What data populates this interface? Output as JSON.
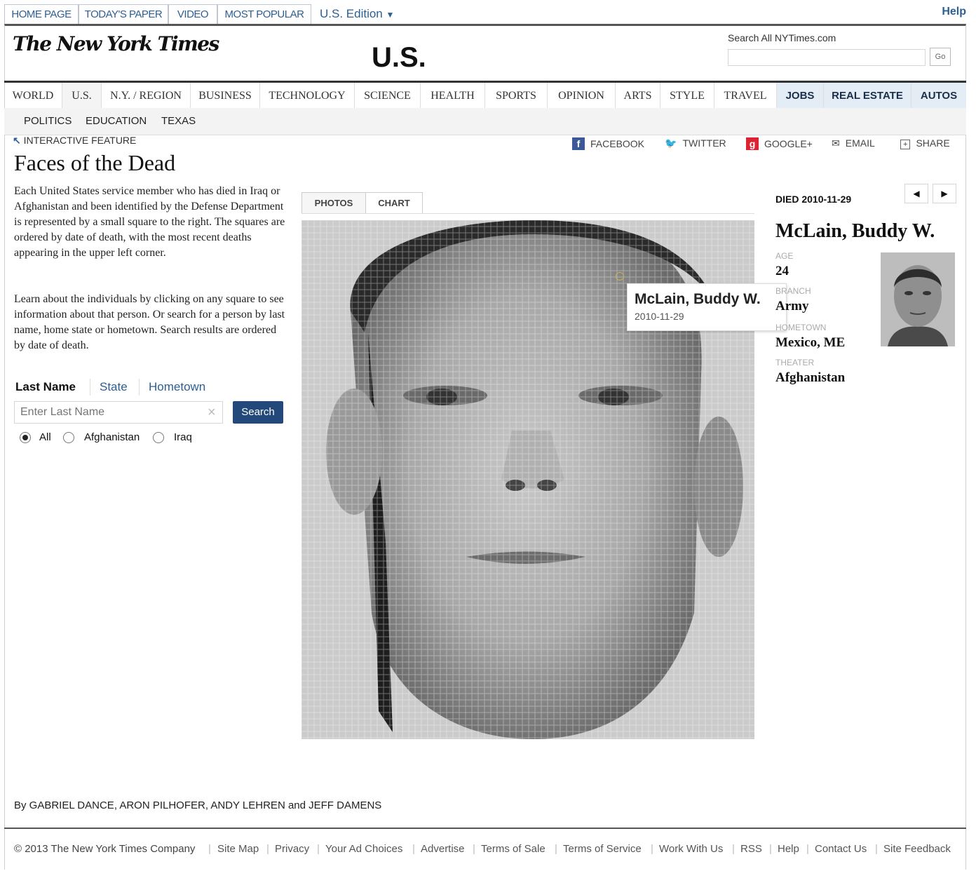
{
  "top_tabs": [
    "HOME PAGE",
    "TODAY'S PAPER",
    "VIDEO",
    "MOST POPULAR"
  ],
  "edition": "U.S. Edition",
  "help": "Help",
  "masthead": "The New York Times",
  "section_title": "U.S.",
  "search_site": {
    "label": "Search All NYTimes.com",
    "go": "Go"
  },
  "nav": [
    "WORLD",
    "U.S.",
    "N.Y. / REGION",
    "BUSINESS",
    "TECHNOLOGY",
    "SCIENCE",
    "HEALTH",
    "SPORTS",
    "OPINION",
    "ARTS",
    "STYLE",
    "TRAVEL",
    "JOBS",
    "REAL ESTATE",
    "AUTOS"
  ],
  "subnav": [
    "POLITICS",
    "EDUCATION",
    "TEXAS"
  ],
  "kicker": "INTERACTIVE FEATURE",
  "headline": "Faces of the Dead",
  "intro_p1": "Each United States service member who has died in Iraq or Afghanistan and been identified by the Defense Department is represented by a small square to the right. The squares are ordered by date of death, with the most recent deaths appearing in the upper left corner.",
  "intro_p2": "Learn about the individuals by clicking on any square to see information about that person. Or search for a person by last name, home state or hometown. Search results are ordered by date of death.",
  "search_tabs": [
    "Last Name",
    "State",
    "Hometown"
  ],
  "search": {
    "placeholder": "Enter Last Name",
    "button": "Search",
    "clear": "×"
  },
  "radios": [
    "All",
    "Afghanistan",
    "Iraq"
  ],
  "share": [
    "FACEBOOK",
    "TWITTER",
    "GOOGLE+",
    "EMAIL",
    "SHARE"
  ],
  "view_tabs": [
    "PHOTOS",
    "CHART"
  ],
  "tooltip": {
    "name": "McLain, Buddy W.",
    "date": "2010-11-29"
  },
  "profile": {
    "died": "DIED 2010-11-29",
    "name": "McLain, Buddy W.",
    "age_label": "AGE",
    "age": "24",
    "branch_label": "BRANCH",
    "branch": "Army",
    "hometown_label": "HOMETOWN",
    "hometown": "Mexico, ME",
    "theater_label": "THEATER",
    "theater": "Afghanistan",
    "prev": "◀",
    "next": "▶"
  },
  "byline": "By GABRIEL DANCE, ARON PILHOFER, ANDY LEHREN and JEFF DAMENS",
  "footer": [
    "© 2013 The New York Times Company",
    "Site Map",
    "Privacy",
    "Your Ad Choices",
    "Advertise",
    "Terms of Sale",
    "Terms of Service",
    "Work With Us",
    "RSS",
    "Help",
    "Contact Us",
    "Site Feedback"
  ]
}
